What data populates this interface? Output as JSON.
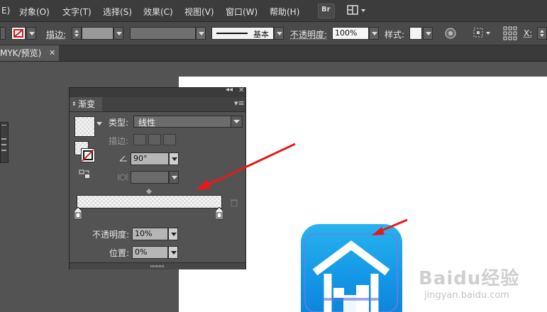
{
  "menubar": {
    "items": [
      "E)",
      "对象(O)",
      "文字(T)",
      "选择(S)",
      "效果(C)",
      "视图(V)",
      "窗口(W)",
      "帮助(H)"
    ],
    "bridge_label": "Br"
  },
  "controlbar": {
    "stroke_label": "描边:",
    "stroke_style": "基本",
    "opacity_label": "不透明度:",
    "opacity_value": "100%",
    "style_label": "样式:",
    "x_label": "X:"
  },
  "document": {
    "tab_title": "MYK/预览)"
  },
  "gradient_panel": {
    "title": "渐变",
    "type_label": "类型:",
    "type_value": "线性",
    "stroke_label": "描边:",
    "angle_value": "90°",
    "opacity_label": "不透明度:",
    "opacity_value": "10%",
    "position_label": "位置:",
    "position_value": "0%"
  },
  "watermark": {
    "brand": "Baidu经验",
    "url": "jingyan.baidu.com"
  },
  "colors": {
    "arrow": "#e8191b",
    "icon_blue": "#1a9ee8",
    "panel_bg": "#535353"
  }
}
